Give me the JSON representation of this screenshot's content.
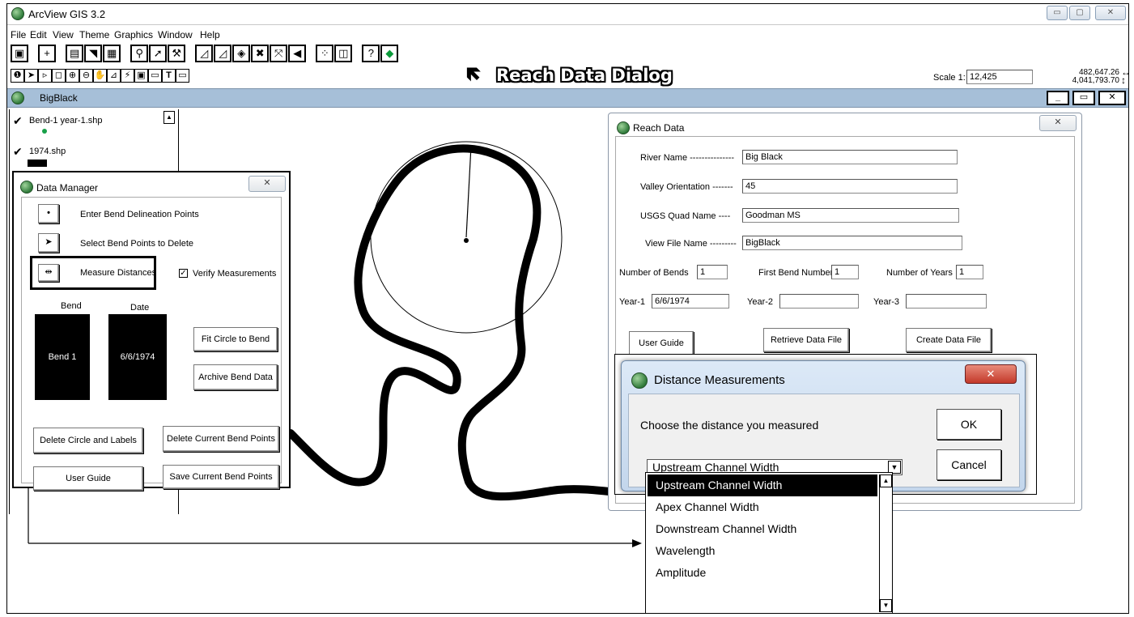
{
  "app": {
    "title": "ArcView GIS 3.2",
    "window_buttons": [
      "▭",
      "▢",
      "✕"
    ]
  },
  "menu": [
    "File",
    "Edit",
    "View",
    "Theme",
    "Graphics",
    "Window",
    "Help"
  ],
  "toolbar": {
    "callout": "Reach Data Dialog",
    "scale_label": "Scale 1:",
    "scale_value": "12,425",
    "coord_x": "482,647.26",
    "coord_y": "4,041,793.70"
  },
  "view": {
    "title": "BigBlack",
    "buttons": [
      "_",
      "▭",
      "✕"
    ]
  },
  "legend": {
    "themes": [
      {
        "name": "Bend-1 year-1.shp",
        "checked": true
      },
      {
        "name": "1974.shp",
        "checked": true
      }
    ]
  },
  "data_manager": {
    "title": "Data Manager",
    "close": "✕",
    "items": {
      "enter_points": "Enter Bend Delineation Points",
      "select_delete": "Select Bend Points to Delete",
      "measure": "Measure Distances"
    },
    "verify_label": "Verify Measurements",
    "verify_checked": true,
    "col_bend": "Bend",
    "col_date": "Date",
    "bend_value": "Bend 1",
    "date_value": "6/6/1974",
    "fit_circle": "Fit Circle to Bend",
    "archive": "Archive Bend Data",
    "delete_circle": "Delete Circle and Labels",
    "delete_points": "Delete Current Bend Points",
    "user_guide": "User Guide",
    "save_points": "Save Current Bend Points"
  },
  "reach_data": {
    "title": "Reach Data",
    "close": "✕",
    "river_label": "River Name ---------------",
    "river_value": "Big Black",
    "valley_label": "Valley Orientation -------",
    "valley_value": "45",
    "quad_label": "USGS Quad Name ----",
    "quad_value": "Goodman MS",
    "viewfile_label": "View File Name ---------",
    "viewfile_value": "BigBlack",
    "nbends_label": "Number of Bends",
    "nbends_value": "1",
    "firstbend_label": "First Bend Number",
    "firstbend_value": "1",
    "nyears_label": "Number of Years",
    "nyears_value": "1",
    "year1_label": "Year-1",
    "year1_value": "6/6/1974",
    "year2_label": "Year-2",
    "year2_value": "",
    "year3_label": "Year-3",
    "year3_value": "",
    "user_guide": "User Guide",
    "retrieve": "Retrieve Data File",
    "create": "Create Data File"
  },
  "distance_dialog": {
    "title": "Distance Measurements",
    "close": "✕",
    "prompt": "Choose the distance you measured",
    "ok": "OK",
    "cancel": "Cancel",
    "selected": "Upstream Channel Width",
    "options": [
      "Upstream Channel Width",
      "Apex Channel Width",
      "Downstream Channel Width",
      "Wavelength",
      "Amplitude"
    ]
  }
}
